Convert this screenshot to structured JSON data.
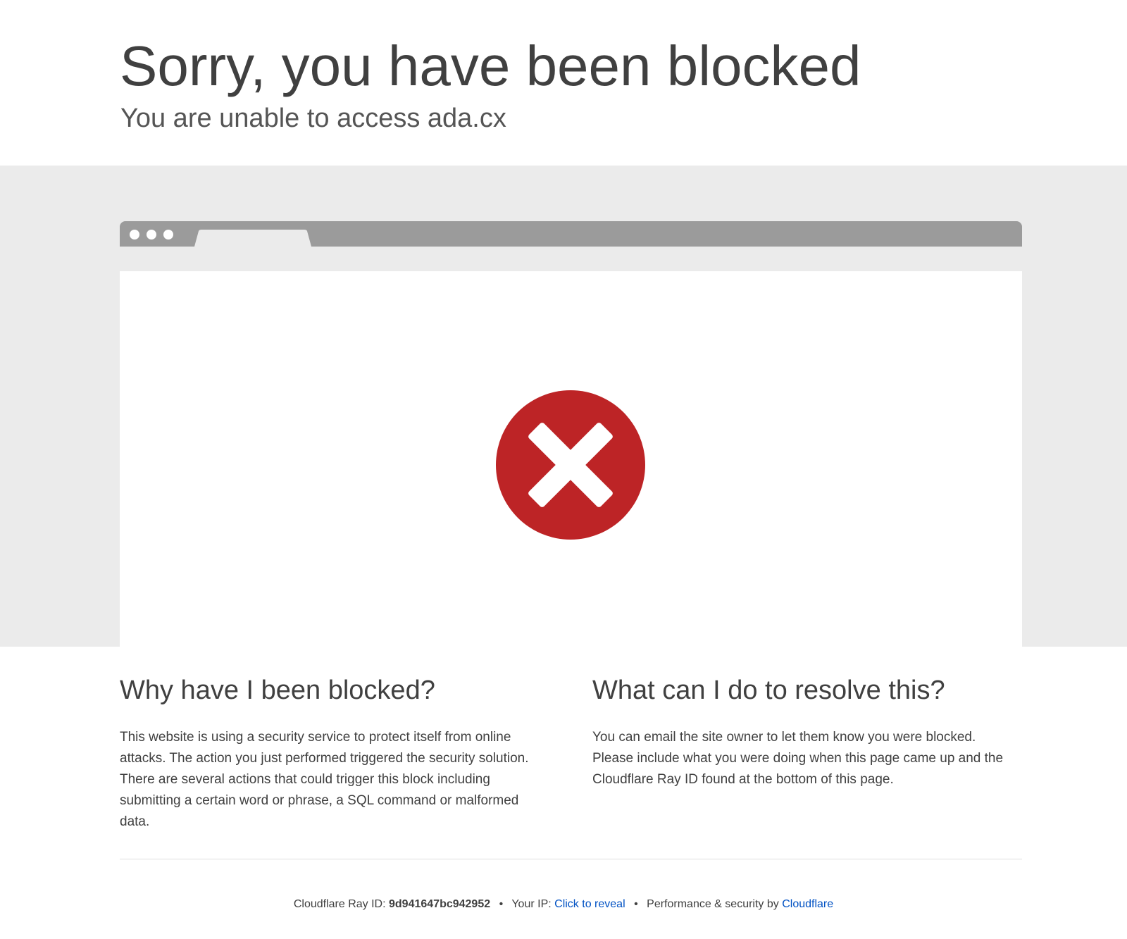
{
  "header": {
    "title": "Sorry, you have been blocked",
    "subtitle": "You are unable to access ada.cx"
  },
  "colors": {
    "error_red": "#bd2426",
    "browser_chrome": "#9b9b9b",
    "band_grey": "#ebebeb",
    "link_blue": "#0051c3"
  },
  "illustration": {
    "icon": "error-x-icon"
  },
  "why": {
    "heading": "Why have I been blocked?",
    "body": "This website is using a security service to protect itself from online attacks. The action you just performed triggered the security solution. There are several actions that could trigger this block including submitting a certain word or phrase, a SQL command or malformed data."
  },
  "resolve": {
    "heading": "What can I do to resolve this?",
    "body": "You can email the site owner to let them know you were blocked. Please include what you were doing when this page came up and the Cloudflare Ray ID found at the bottom of this page."
  },
  "footer": {
    "ray_label": "Cloudflare Ray ID:",
    "ray_id": "9d941647bc942952",
    "bullet": "•",
    "ip_label": "Your IP:",
    "ip_link": "Click to reveal",
    "perf_label": "Performance & security by",
    "cf_link": "Cloudflare"
  }
}
